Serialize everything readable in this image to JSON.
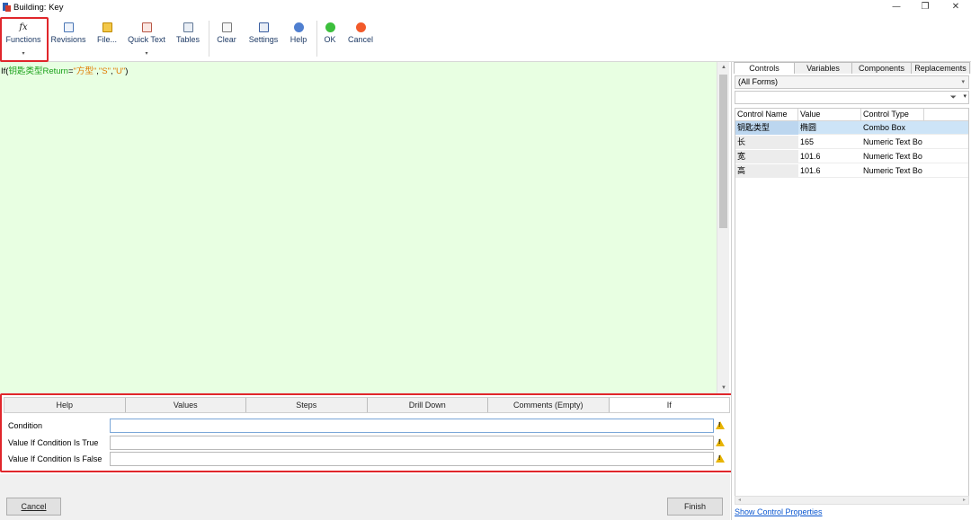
{
  "window": {
    "title": "Building: Key",
    "controls": {
      "minimize": "—",
      "restore": "❐",
      "close": "✕"
    }
  },
  "toolbar": {
    "functions": {
      "label": "Functions",
      "icon": "fx-icon",
      "arrow": "▾"
    },
    "revisions": {
      "label": "Revisions",
      "icon": "document-icon"
    },
    "file": {
      "label": "File...",
      "icon": "file-icon"
    },
    "quick_text": {
      "label": "Quick Text",
      "icon": "quick-text-icon",
      "arrow": "▾"
    },
    "tables": {
      "label": "Tables",
      "icon": "table-icon"
    },
    "clear": {
      "label": "Clear",
      "icon": "clear-icon"
    },
    "settings": {
      "label": "Settings",
      "icon": "settings-icon"
    },
    "help": {
      "label": "Help",
      "icon": "help-icon"
    },
    "ok": {
      "label": "OK",
      "icon": "green-circle-icon"
    },
    "cancel": {
      "label": "Cancel",
      "icon": "red-circle-icon"
    }
  },
  "editor": {
    "tokens": {
      "fn": "If(",
      "control": "钥匙类型Return",
      "op": "=",
      "str1": "\"方型\"",
      "c1": ",",
      "str2": "\"S\"",
      "c2": ",",
      "str3": "\"U\"",
      "close": ")"
    }
  },
  "properties_panel": {
    "tabs": [
      "Help",
      "Values",
      "Steps",
      "Drill Down",
      "Comments (Empty)",
      "If"
    ],
    "active_tab": "If",
    "fields": [
      {
        "label": "Condition",
        "value": ""
      },
      {
        "label": "Value If Condition Is True",
        "value": ""
      },
      {
        "label": "Value If Condition Is False",
        "value": ""
      }
    ],
    "warning_glyph": "!"
  },
  "footer": {
    "cancel_label": "Cancel",
    "finish_label": "Finish"
  },
  "right_panel": {
    "tabs": [
      "Controls",
      "Variables",
      "Components",
      "Replacements"
    ],
    "active_tab": "Controls",
    "form_filter": "(All Forms)",
    "search_value": "",
    "columns": [
      "Control Name",
      "Value",
      "Control Type"
    ],
    "rows": [
      {
        "name": "钥匙类型",
        "value": "椭圆",
        "type": "Combo Box",
        "selected": true
      },
      {
        "name": "长",
        "value": "165",
        "type": "Numeric Text Bo"
      },
      {
        "name": "宽",
        "value": "101.6",
        "type": "Numeric Text Bo"
      },
      {
        "name": "高",
        "value": "101.6",
        "type": "Numeric Text Bo"
      }
    ],
    "show_props_link": "Show Control Properties"
  },
  "colors": {
    "editor_bg": "#e8ffe2",
    "highlight": "#e0262b",
    "control_token": "#18a018",
    "string_token": "#e07a00",
    "selected_row": "#cde4f7"
  }
}
